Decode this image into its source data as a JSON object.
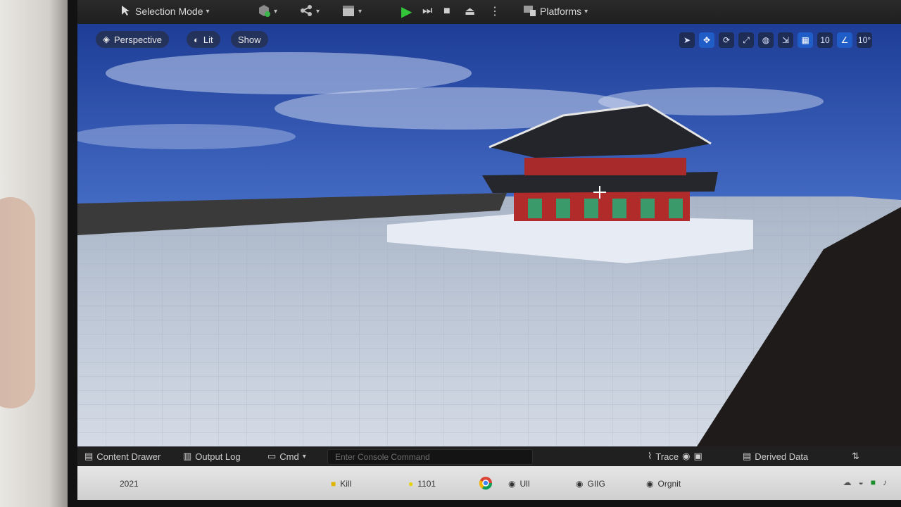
{
  "toolbar": {
    "selection_mode": "Selection Mode",
    "platforms": "Platforms"
  },
  "viewport": {
    "perspective": "Perspective",
    "lit": "Lit",
    "show": "Show",
    "tool_labels": [
      "10",
      "10°"
    ]
  },
  "statusbar": {
    "content_drawer": "Content Drawer",
    "output_log": "Output Log",
    "cmd": "Cmd",
    "console_placeholder": "Enter Console Command",
    "trace": "Trace",
    "derived_data": "Derived Data"
  },
  "taskbar": {
    "items": [
      "2021",
      "Kill",
      "1101",
      "Ull",
      "GIIG",
      "Orgnit"
    ]
  },
  "colors": {
    "sky_top": "#1d3f9c",
    "sky_mid": "#4f7ad3",
    "ground": "#c6cfdb",
    "roof": "#24262b",
    "pillar": "#b12a2a",
    "window": "#3b9a6a",
    "play": "#33c63b"
  }
}
